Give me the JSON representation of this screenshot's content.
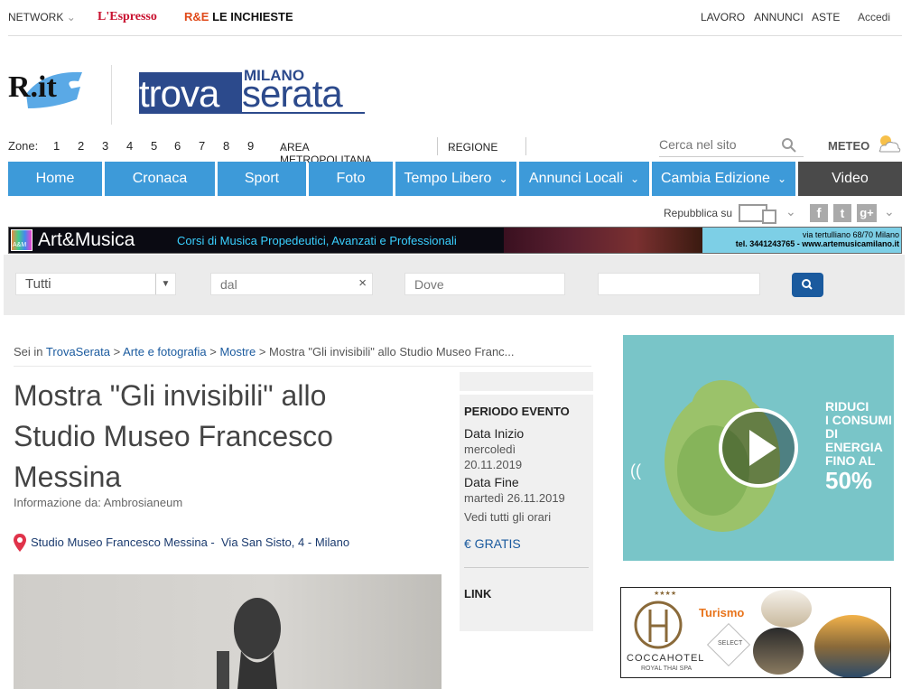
{
  "topbar": {
    "network": "NETWORK",
    "espresso": "L'Espresso",
    "inchieste_prefix": "R&E",
    "inchieste": "LE INCHIESTE",
    "lavoro": "LAVORO",
    "annunci": "ANNUNCI",
    "aste": "ASTE",
    "accedi": "Accedi"
  },
  "brand": {
    "ri": "R.it",
    "city": "MILANO",
    "trova": "trova",
    "serata": "serata"
  },
  "zones": {
    "label": "Zone:",
    "numbers": [
      "1",
      "2",
      "3",
      "4",
      "5",
      "6",
      "7",
      "8",
      "9"
    ],
    "area": "AREA METROPOLITANA",
    "regione": "REGIONE",
    "search_placeholder": "Cerca nel sito",
    "meteo": "METEO"
  },
  "nav": {
    "items": [
      "Home",
      "Cronaca",
      "Sport",
      "Foto",
      "Tempo Libero",
      "Annunci Locali",
      "Cambia Edizione",
      "Video"
    ]
  },
  "social": {
    "repubblica_su": "Repubblica su",
    "twitter": "t",
    "gplus": "g+"
  },
  "banner": {
    "logo": "Art&Musica",
    "badge": "A&M",
    "text": "Corsi di Musica Propedeutici, Avanzati e Professionali",
    "address": "via tertulliano 68/70 Milano",
    "contact": "tel. 3441243765 - www.artemusicamilano.it"
  },
  "filters": {
    "category": "Tutti",
    "from_placeholder": "dal",
    "where_placeholder": "Dove"
  },
  "breadcrumb": {
    "prefix": "Sei in",
    "home": "TrovaSerata",
    "cat": "Arte e fotografia",
    "sub": "Mostre",
    "current": "Mostra \"Gli invisibili\" allo Studio Museo Franc..."
  },
  "event": {
    "title_line1": "Mostra \"Gli invisibili\" allo",
    "title_line2": "Studio Museo Francesco",
    "title_line3": "Messina",
    "source": "Informazione da: Ambrosianeum",
    "venue": "Studio Museo Francesco Messina -",
    "address": "Via San Sisto, 4 - Milano"
  },
  "side": {
    "period_label": "PERIODO EVENTO",
    "start_label": "Data Inizio",
    "start_day": "mercoledì",
    "start_date": "20.11.2019",
    "end_label": "Data Fine",
    "end_value": "martedì 26.11.2019",
    "all_hours": "Vedi tutti gli orari",
    "price": "€ GRATIS",
    "link": "LINK"
  },
  "ad1": {
    "line1": "RIDUCI",
    "line2": "I CONSUMI",
    "line3": "DI ENERGIA",
    "line4": "FINO AL",
    "pct": "50%"
  },
  "ad2": {
    "stars": "★★★★",
    "name": "COCCAHOTEL",
    "sub": "ROYAL THAI SPA",
    "tourism": "Turismo",
    "select": "SELECT"
  },
  "colors": {
    "nav_blue": "#3d9ad9",
    "video_bg": "#4a4a4a",
    "brand_blue": "#2c4a8c"
  }
}
